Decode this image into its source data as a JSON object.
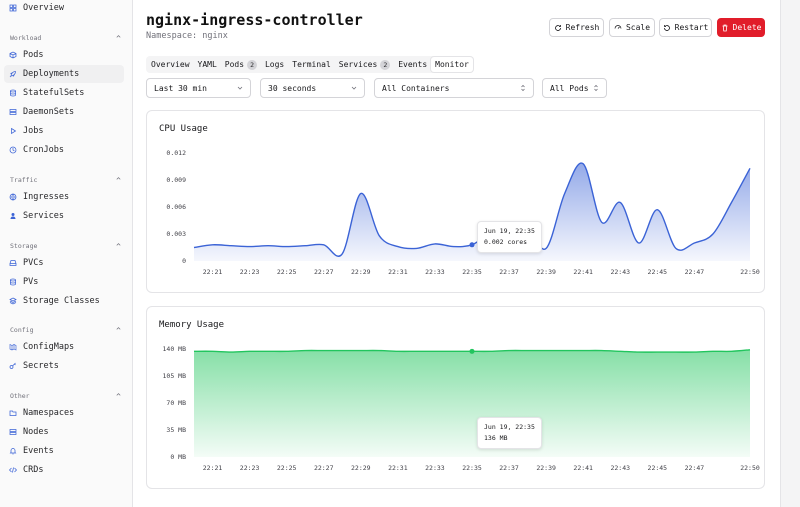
{
  "sidebar": {
    "top_item": {
      "label": "Overview",
      "icon": "grid-icon"
    },
    "groups": [
      {
        "label": "Workload",
        "items": [
          {
            "label": "Pods",
            "icon": "box-icon"
          },
          {
            "label": "Deployments",
            "icon": "rocket-icon",
            "active": true
          },
          {
            "label": "StatefulSets",
            "icon": "database-icon"
          },
          {
            "label": "DaemonSets",
            "icon": "server-icon"
          },
          {
            "label": "Jobs",
            "icon": "play-icon"
          },
          {
            "label": "CronJobs",
            "icon": "clock-icon"
          }
        ]
      },
      {
        "label": "Traffic",
        "items": [
          {
            "label": "Ingresses",
            "icon": "globe-icon"
          },
          {
            "label": "Services",
            "icon": "network-icon"
          }
        ]
      },
      {
        "label": "Storage",
        "items": [
          {
            "label": "PVCs",
            "icon": "hard-drive-icon"
          },
          {
            "label": "PVs",
            "icon": "database-icon"
          },
          {
            "label": "Storage Classes",
            "icon": "layers-icon"
          }
        ]
      },
      {
        "label": "Config",
        "items": [
          {
            "label": "ConfigMaps",
            "icon": "map-icon"
          },
          {
            "label": "Secrets",
            "icon": "key-icon"
          }
        ]
      },
      {
        "label": "Other",
        "items": [
          {
            "label": "Namespaces",
            "icon": "folder-icon"
          },
          {
            "label": "Nodes",
            "icon": "server-icon"
          },
          {
            "label": "Events",
            "icon": "bell-icon"
          },
          {
            "label": "CRDs",
            "icon": "code-icon"
          }
        ]
      }
    ]
  },
  "header": {
    "title": "nginx-ingress-controller",
    "namespace": "Namespace: nginx",
    "buttons": {
      "refresh": "Refresh",
      "scale": "Scale",
      "restart": "Restart",
      "delete": "Delete"
    },
    "accent_danger": "#e11d2a"
  },
  "tabs": [
    {
      "label": "Overview"
    },
    {
      "label": "YAML"
    },
    {
      "label": "Pods",
      "badge": "2"
    },
    {
      "label": "Logs"
    },
    {
      "label": "Terminal"
    },
    {
      "label": "Services",
      "badge": "2"
    },
    {
      "label": "Events"
    },
    {
      "label": "Monitor",
      "active": true
    }
  ],
  "filters": {
    "time_range": "Last 30 min",
    "refresh_interval": "30 seconds",
    "container": "All Containers",
    "pods": "All Pods"
  },
  "cpu": {
    "title": "CPU Usage",
    "tooltip_time": "Jun 19, 22:35",
    "tooltip_value": "0.002 cores",
    "color": "#3b63d6"
  },
  "memory": {
    "title": "Memory Usage",
    "tooltip_time": "Jun 19, 22:35",
    "tooltip_value": "136 MB",
    "color": "#22c55e"
  },
  "chart_data": [
    {
      "type": "area",
      "title": "CPU Usage",
      "x": [
        "22:20",
        "22:21",
        "22:22",
        "22:23",
        "22:24",
        "22:25",
        "22:26",
        "22:27",
        "22:28",
        "22:29",
        "22:30",
        "22:31",
        "22:32",
        "22:33",
        "22:34",
        "22:35",
        "22:36",
        "22:37",
        "22:38",
        "22:39",
        "22:40",
        "22:41",
        "22:42",
        "22:43",
        "22:44",
        "22:45",
        "22:46",
        "22:47",
        "22:48",
        "22:49",
        "22:50"
      ],
      "x_ticks": [
        "22:21",
        "22:23",
        "22:25",
        "22:27",
        "22:29",
        "22:31",
        "22:33",
        "22:35",
        "22:37",
        "22:39",
        "22:41",
        "22:43",
        "22:45",
        "22:47",
        "22:50"
      ],
      "y_ticks": [
        "0",
        "0.003",
        "0.006",
        "0.009",
        "0.012"
      ],
      "series": [
        {
          "values": [
            0.0015,
            0.0018,
            0.0017,
            0.0016,
            0.0017,
            0.0016,
            0.0017,
            0.0018,
            0.0008,
            0.0075,
            0.0028,
            0.0016,
            0.0014,
            0.0019,
            0.0016,
            0.0018,
            0.003,
            0.0026,
            0.0036,
            0.0014,
            0.0075,
            0.0108,
            0.0043,
            0.0065,
            0.002,
            0.0057,
            0.0014,
            0.002,
            0.003,
            0.0065,
            0.0103
          ]
        }
      ],
      "ylim": [
        0,
        0.012
      ]
    },
    {
      "type": "area",
      "title": "Memory Usage",
      "x": [
        "22:20",
        "22:21",
        "22:22",
        "22:23",
        "22:24",
        "22:25",
        "22:26",
        "22:27",
        "22:28",
        "22:29",
        "22:30",
        "22:31",
        "22:32",
        "22:33",
        "22:34",
        "22:35",
        "22:36",
        "22:37",
        "22:38",
        "22:39",
        "22:40",
        "22:41",
        "22:42",
        "22:43",
        "22:44",
        "22:45",
        "22:46",
        "22:47",
        "22:48",
        "22:49",
        "22:50"
      ],
      "x_ticks": [
        "22:21",
        "22:23",
        "22:25",
        "22:27",
        "22:29",
        "22:31",
        "22:33",
        "22:35",
        "22:37",
        "22:39",
        "22:41",
        "22:43",
        "22:45",
        "22:47",
        "22:50"
      ],
      "y_ticks": [
        "0 MB",
        "35 MB",
        "70 MB",
        "105 MB",
        "140 MB"
      ],
      "y_tick_values": [
        0,
        35,
        70,
        105,
        140
      ],
      "series": [
        {
          "values": [
            137,
            137,
            136,
            137,
            137,
            137,
            138,
            138,
            138,
            138,
            138,
            137,
            137,
            137,
            137,
            137,
            137,
            138,
            138,
            138,
            138,
            138,
            138,
            137,
            136,
            136,
            136,
            136,
            137,
            137,
            139
          ]
        }
      ],
      "ylim": [
        0,
        140
      ]
    }
  ]
}
